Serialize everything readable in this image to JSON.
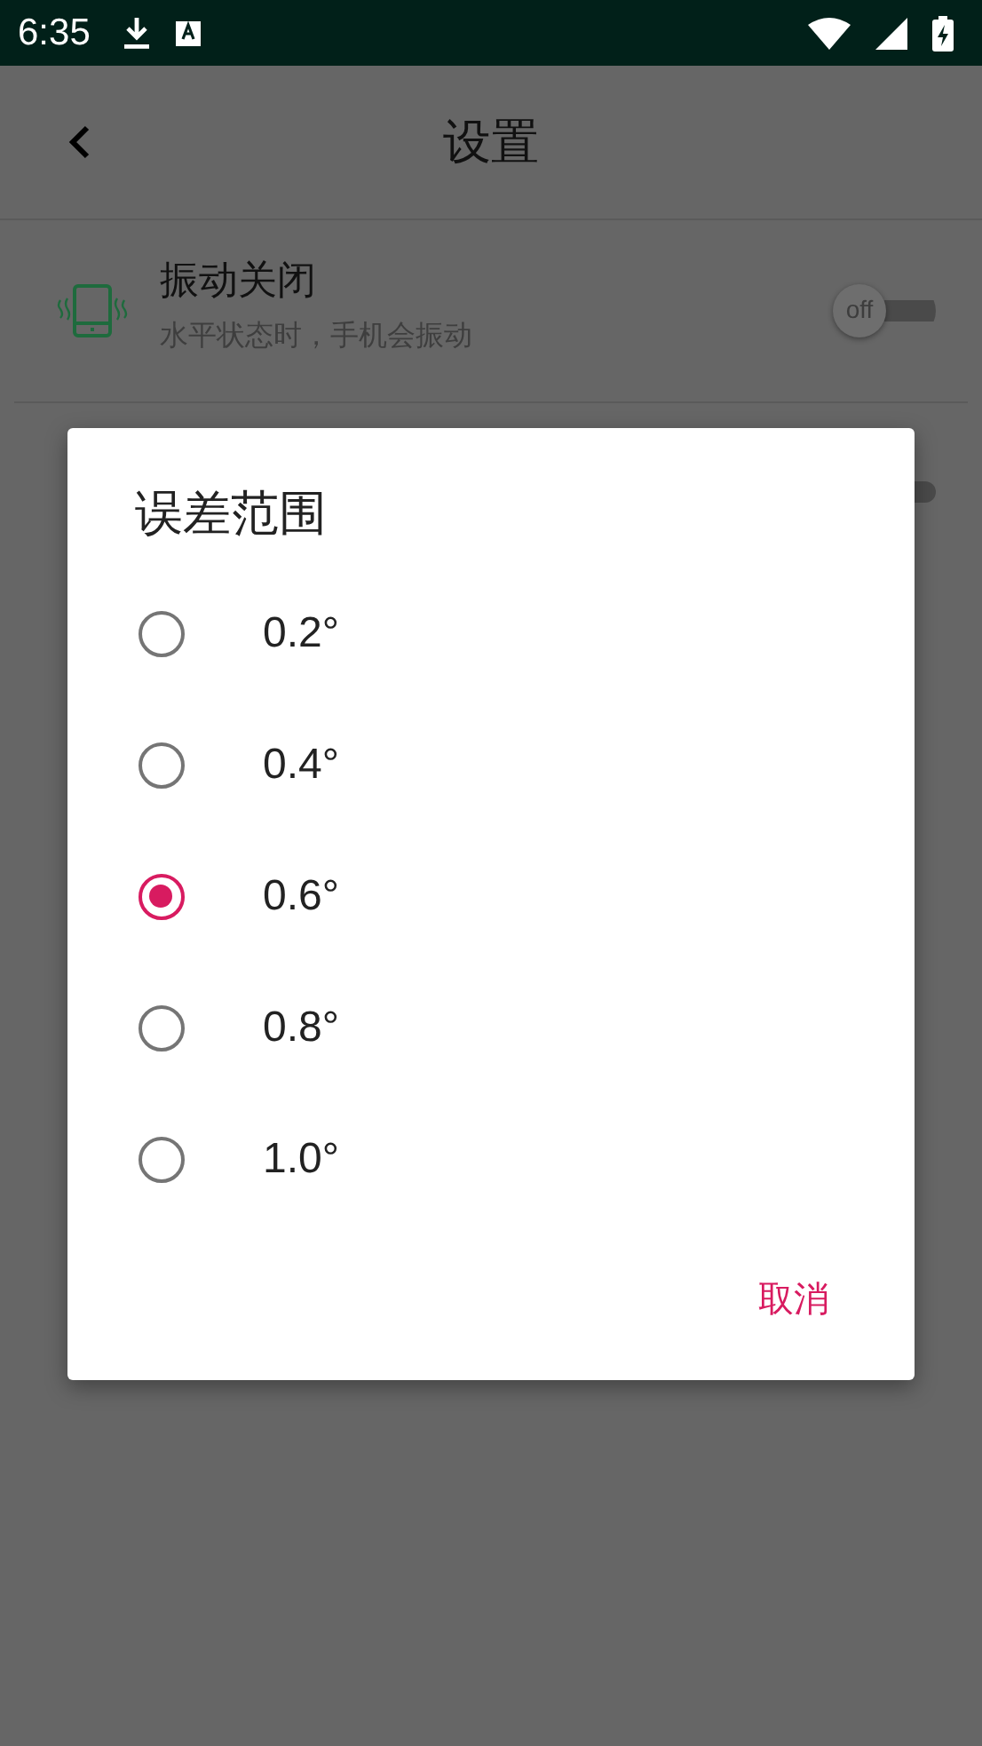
{
  "status_bar": {
    "time": "6:35"
  },
  "toolbar": {
    "title": "设置"
  },
  "settings": [
    {
      "title": "振动关闭",
      "subtitle": "水平状态时，手机会振动",
      "switch_label": "off",
      "on": false
    }
  ],
  "dialog": {
    "title": "误差范围",
    "options": [
      {
        "label": "0.2°",
        "selected": false
      },
      {
        "label": "0.4°",
        "selected": false
      },
      {
        "label": "0.6°",
        "selected": true
      },
      {
        "label": "0.8°",
        "selected": false
      },
      {
        "label": "1.0°",
        "selected": false
      }
    ],
    "cancel": "取消"
  }
}
